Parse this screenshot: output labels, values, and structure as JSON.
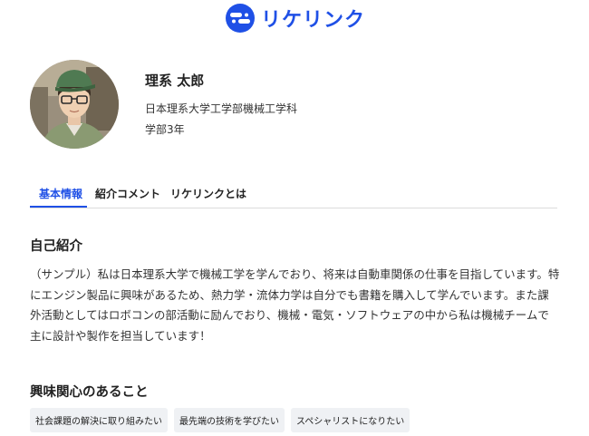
{
  "header": {
    "logo_text": "リケリンク"
  },
  "profile": {
    "name": "理系 太郎",
    "university": "日本理系大学工学部機械工学科",
    "year": "学部3年"
  },
  "tabs": [
    {
      "label": "基本情報",
      "active": true
    },
    {
      "label": "紹介コメント",
      "active": false
    },
    {
      "label": "リケリンクとは",
      "active": false
    }
  ],
  "self_intro": {
    "title": "自己紹介",
    "body": "（サンプル）私は日本理系大学で機械工学を学んでおり、将来は自動車関係の仕事を目指しています。特にエンジン製品に興味があるため、熱力学・流体力学は自分でも書籍を購入して学んでいます。また課外活動としてはロボコンの部活動に励んでおり、機械・電気・ソフトウェアの中から私は機械チームで主に設計や製作を担当しています！"
  },
  "interests": {
    "title": "興味関心のあること",
    "tags": [
      "社会課題の解決に取り組みたい",
      "最先端の技術を学びたい",
      "スペシャリストになりたい"
    ]
  },
  "colors": {
    "brand": "#1f50e6",
    "tag_bg": "#eff1f4"
  }
}
